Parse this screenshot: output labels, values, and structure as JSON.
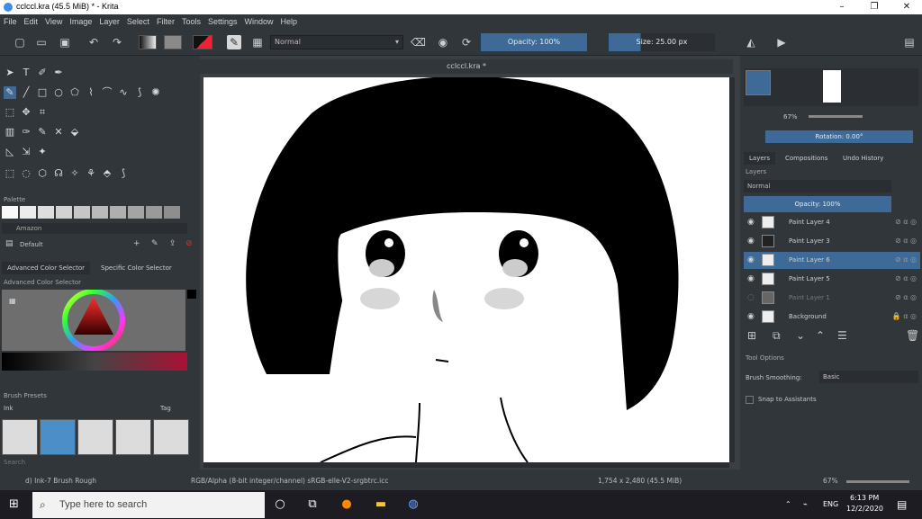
{
  "window": {
    "title": "cclccl.kra (45.5 MiB)  * - Krita",
    "minimize": "–",
    "maximize": "❐",
    "close": "✕"
  },
  "menu": [
    "File",
    "Edit",
    "View",
    "Image",
    "Layer",
    "Select",
    "Filter",
    "Tools",
    "Settings",
    "Window",
    "Help"
  ],
  "toolbar": {
    "blend_mode": "Normal",
    "opacity_label": "Opacity: 100%",
    "size_label": "Size: 25.00 px"
  },
  "left_dock": {
    "palette_title": "Palette",
    "palette_name": "Amazon",
    "resource_default": "Default",
    "color_tabs": [
      "Advanced Color Selector",
      "Specific Color Selector"
    ],
    "color_selector_title": "Advanced Color Selector",
    "brush_presets_title": "Brush Presets",
    "brush_filter": "Ink",
    "brush_tag": "Tag",
    "search_placeholder": "Search"
  },
  "document": {
    "tab_title": "cclccl.kra *"
  },
  "right_dock": {
    "zoom": "67%",
    "rotation": "Rotation: 0.00°",
    "tabs": [
      "Layers",
      "Compositions",
      "Undo History"
    ],
    "layers_title": "Layers",
    "blend_mode": "Normal",
    "opacity_label": "Opacity:  100%",
    "layers": [
      {
        "name": "Paint Layer 4",
        "selected": false,
        "visible": true
      },
      {
        "name": "Paint Layer 3",
        "selected": false,
        "visible": true
      },
      {
        "name": "Paint Layer 6",
        "selected": true,
        "visible": true
      },
      {
        "name": "Paint Layer 5",
        "selected": false,
        "visible": true
      },
      {
        "name": "Paint Layer 1",
        "selected": false,
        "visible": false
      },
      {
        "name": "Background",
        "selected": false,
        "visible": true
      }
    ],
    "tool_options_title": "Tool Options",
    "brush_smoothing_label": "Brush Smoothing:",
    "brush_smoothing_value": "Basic",
    "snap_label": "Snap to Assistants"
  },
  "status": {
    "brush": "d) Ink-7 Brush Rough",
    "color_space": "RGB/Alpha (8-bit integer/channel)  sRGB-elle-V2-srgbtrc.icc",
    "dimensions": "1,754 x 2,480 (45.5 MiB)",
    "zoom": "67%"
  },
  "taskbar": {
    "search_placeholder": "Type here to search",
    "lang": "ENG",
    "time": "6:13 PM",
    "date": "12/2/2020"
  },
  "colors": {
    "accent": "#3e6a98",
    "panel": "#31363b",
    "taskbar": "#1c1c22"
  }
}
